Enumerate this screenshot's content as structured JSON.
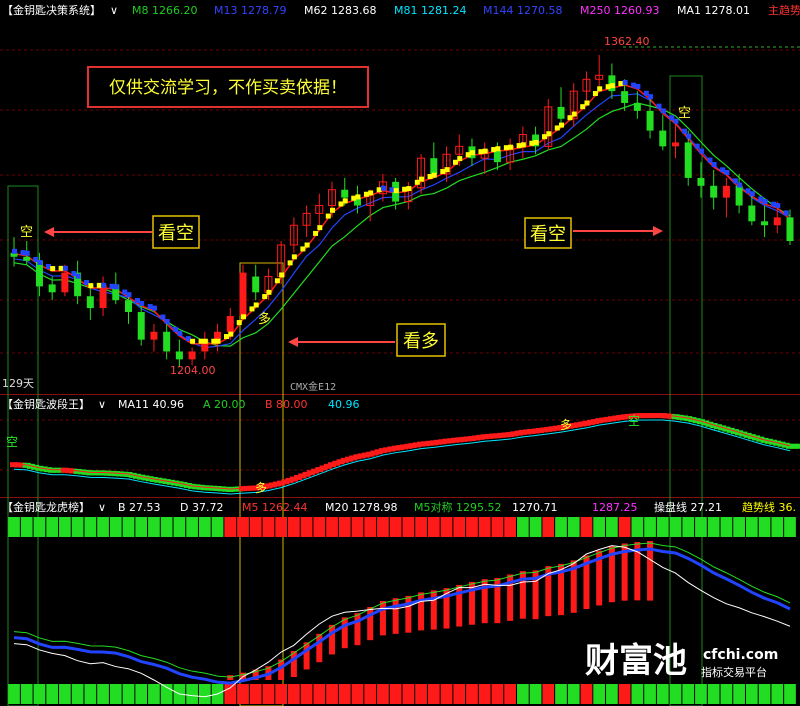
{
  "colors": {
    "bg": "#000000",
    "up": "#ff1a1a",
    "down": "#22dd22",
    "blue": "#2244ff",
    "yellow": "#ffff00",
    "white": "#ffffff",
    "cyan": "#00e5ff",
    "magenta": "#ff33ff",
    "grid_red": "#7a0000",
    "box_yellow": "#e6c200",
    "box_green": "#1b8a1b",
    "arrow_red": "#ff4444"
  },
  "panel1": {
    "header": {
      "name": "【金钥匙决策系统】",
      "ma8": "M8 1266.20",
      "ma13": "M13 1278.79",
      "ma62": "M62 1283.68",
      "ma81": "M81 1281.24",
      "ma144": "M144 1270.58",
      "ma250": "M250 1260.93",
      "ma1": "MA1 1278.01",
      "trend": "主趋势"
    },
    "high_label": "1362.40",
    "low_label": "1204.00",
    "days_label": "129天",
    "instrument": "CMX金E12",
    "disclaimer": "仅供交流学习，不作买卖依据！",
    "signal_kong_left": "看空",
    "signal_kong_right": "看空",
    "signal_duo": "看多",
    "mark_kong": "空",
    "mark_duo": "多"
  },
  "panel2": {
    "header": {
      "name": "【金钥匙波段王】",
      "ma11": "MA11 40.96",
      "a": "A 20.00",
      "b": "B 80.00",
      "val": "40.96"
    },
    "mark_duo_low": "多",
    "mark_duo_high": "多",
    "mark_kong_high": "空",
    "mark_kong_left": "空"
  },
  "panel3": {
    "header": {
      "name": "【金钥匙龙虎榜】",
      "b": "B 27.53",
      "d": "D 37.72",
      "m5": "M5 1262.44",
      "m20": "M20 1278.98",
      "m5s": "M5对称 1295.52",
      "v1": "1270.71",
      "v2": "1287.25",
      "cpx": "操盘线 27.21",
      "qsx": "趋势线 36."
    }
  },
  "watermark": {
    "brand": "财富池",
    "domain": "cfchi.com",
    "slogan": "指标交易平台"
  },
  "chart_data": {
    "type": "candlestick",
    "candles": [
      [
        1262,
        1270,
        1255,
        1260
      ],
      [
        1260,
        1268,
        1256,
        1258
      ],
      [
        1258,
        1262,
        1240,
        1245
      ],
      [
        1246,
        1250,
        1238,
        1242
      ],
      [
        1242,
        1256,
        1240,
        1252
      ],
      [
        1252,
        1258,
        1236,
        1240
      ],
      [
        1240,
        1244,
        1228,
        1234
      ],
      [
        1234,
        1250,
        1230,
        1246
      ],
      [
        1246,
        1252,
        1236,
        1238
      ],
      [
        1238,
        1242,
        1226,
        1232
      ],
      [
        1232,
        1236,
        1215,
        1218
      ],
      [
        1218,
        1226,
        1212,
        1222
      ],
      [
        1222,
        1226,
        1208,
        1212
      ],
      [
        1212,
        1218,
        1204,
        1208
      ],
      [
        1208,
        1214,
        1205,
        1212
      ],
      [
        1212,
        1222,
        1208,
        1218
      ],
      [
        1218,
        1226,
        1212,
        1222
      ],
      [
        1222,
        1234,
        1218,
        1230
      ],
      [
        1230,
        1256,
        1228,
        1252
      ],
      [
        1250,
        1256,
        1238,
        1242
      ],
      [
        1242,
        1254,
        1238,
        1250
      ],
      [
        1250,
        1268,
        1246,
        1266
      ],
      [
        1266,
        1280,
        1262,
        1276
      ],
      [
        1276,
        1286,
        1270,
        1282
      ],
      [
        1282,
        1292,
        1276,
        1286
      ],
      [
        1286,
        1298,
        1280,
        1294
      ],
      [
        1294,
        1300,
        1286,
        1290
      ],
      [
        1290,
        1296,
        1282,
        1286
      ],
      [
        1286,
        1294,
        1278,
        1292
      ],
      [
        1292,
        1302,
        1288,
        1298
      ],
      [
        1298,
        1300,
        1284,
        1288
      ],
      [
        1288,
        1298,
        1284,
        1295
      ],
      [
        1295,
        1312,
        1292,
        1310
      ],
      [
        1310,
        1318,
        1300,
        1302
      ],
      [
        1302,
        1316,
        1298,
        1312
      ],
      [
        1312,
        1322,
        1306,
        1316
      ],
      [
        1316,
        1320,
        1306,
        1310
      ],
      [
        1310,
        1318,
        1302,
        1314
      ],
      [
        1314,
        1318,
        1304,
        1308
      ],
      [
        1308,
        1320,
        1304,
        1316
      ],
      [
        1316,
        1326,
        1310,
        1322
      ],
      [
        1322,
        1326,
        1312,
        1316
      ],
      [
        1316,
        1340,
        1314,
        1336
      ],
      [
        1336,
        1346,
        1326,
        1330
      ],
      [
        1330,
        1348,
        1326,
        1344
      ],
      [
        1344,
        1354,
        1338,
        1350
      ],
      [
        1350,
        1362.4,
        1344,
        1352
      ],
      [
        1352,
        1358,
        1340,
        1344
      ],
      [
        1344,
        1350,
        1334,
        1338
      ],
      [
        1338,
        1344,
        1330,
        1334
      ],
      [
        1334,
        1340,
        1320,
        1324
      ],
      [
        1324,
        1332,
        1314,
        1316
      ],
      [
        1316,
        1330,
        1310,
        1318
      ],
      [
        1318,
        1324,
        1296,
        1300
      ],
      [
        1300,
        1308,
        1290,
        1296
      ],
      [
        1296,
        1304,
        1284,
        1290
      ],
      [
        1290,
        1300,
        1280,
        1296
      ],
      [
        1296,
        1302,
        1282,
        1286
      ],
      [
        1286,
        1292,
        1276,
        1278
      ],
      [
        1278,
        1286,
        1270,
        1276
      ],
      [
        1276,
        1288,
        1272,
        1280
      ],
      [
        1280,
        1284,
        1266,
        1268
      ]
    ],
    "ylim": [
      1195,
      1375
    ]
  }
}
